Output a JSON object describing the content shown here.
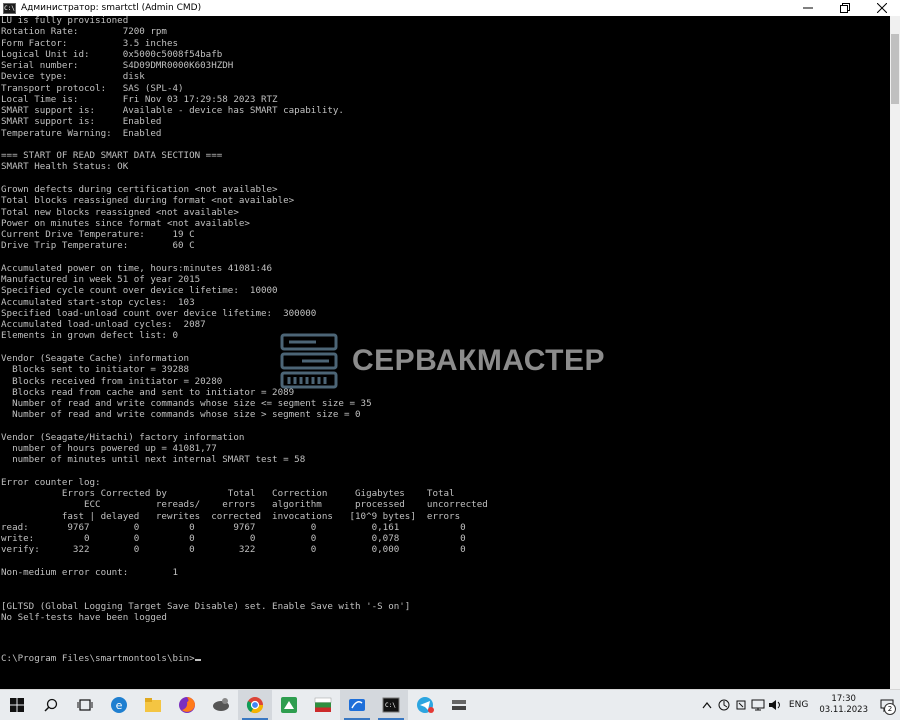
{
  "window": {
    "title": "Администратор: smartctl (Admin CMD)",
    "icon_label": "C:\\"
  },
  "console": {
    "lines": [
      "LU is fully provisioned",
      "Rotation Rate:        7200 rpm",
      "Form Factor:          3.5 inches",
      "Logical Unit id:      0x5000c5008f54bafb",
      "Serial number:        S4D09DMR0000K603HZDH",
      "Device type:          disk",
      "Transport protocol:   SAS (SPL-4)",
      "Local Time is:        Fri Nov 03 17:29:58 2023 RTZ",
      "SMART support is:     Available - device has SMART capability.",
      "SMART support is:     Enabled",
      "Temperature Warning:  Enabled",
      "",
      "=== START OF READ SMART DATA SECTION ===",
      "SMART Health Status: OK",
      "",
      "Grown defects during certification <not available>",
      "Total blocks reassigned during format <not available>",
      "Total new blocks reassigned <not available>",
      "Power on minutes since format <not available>",
      "Current Drive Temperature:     19 C",
      "Drive Trip Temperature:        60 C",
      "",
      "Accumulated power on time, hours:minutes 41081:46",
      "Manufactured in week 51 of year 2015",
      "Specified cycle count over device lifetime:  10000",
      "Accumulated start-stop cycles:  103",
      "Specified load-unload count over device lifetime:  300000",
      "Accumulated load-unload cycles:  2087",
      "Elements in grown defect list: 0",
      "",
      "Vendor (Seagate Cache) information",
      "  Blocks sent to initiator = 39288",
      "  Blocks received from initiator = 20280",
      "  Blocks read from cache and sent to initiator = 2089",
      "  Number of read and write commands whose size <= segment size = 35",
      "  Number of read and write commands whose size > segment size = 0",
      "",
      "Vendor (Seagate/Hitachi) factory information",
      "  number of hours powered up = 41081,77",
      "  number of minutes until next internal SMART test = 58",
      "",
      "Error counter log:",
      "           Errors Corrected by           Total   Correction     Gigabytes    Total",
      "               ECC          rereads/    errors   algorithm      processed    uncorrected",
      "           fast | delayed   rewrites  corrected  invocations   [10^9 bytes]  errors",
      "read:       9767        0         0       9767          0          0,161           0",
      "write:         0        0         0          0          0          0,078           0",
      "verify:      322        0         0        322          0          0,000           0",
      "",
      "Non-medium error count:        1",
      "",
      "",
      "[GLTSD (Global Logging Target Save Disable) set. Enable Save with '-S on']",
      "No Self-tests have been logged",
      "",
      "",
      "C:\\Program Files\\smartmontools\\bin>"
    ]
  },
  "watermark": {
    "text": "СЕРВАКМАСТЕР",
    "color": "#7fb3d6"
  },
  "taskbar": {
    "items": [
      {
        "name": "start-button",
        "icon": "windows-logo"
      },
      {
        "name": "search-button",
        "icon": "search-icon"
      },
      {
        "name": "task-view-button",
        "icon": "task-view-icon"
      },
      {
        "name": "edge-button",
        "icon": "edge-icon"
      },
      {
        "name": "file-explorer-button",
        "icon": "folder-icon"
      },
      {
        "name": "firefox-button",
        "icon": "firefox-icon"
      },
      {
        "name": "app-button-1",
        "icon": "app-icon"
      },
      {
        "name": "chrome-button",
        "icon": "chrome-icon"
      },
      {
        "name": "app-button-2",
        "icon": "app-icon"
      },
      {
        "name": "app-button-3",
        "icon": "app-icon"
      },
      {
        "name": "app-button-4",
        "icon": "app-icon"
      },
      {
        "name": "cmd-button",
        "icon": "cmd-icon"
      },
      {
        "name": "telegram-button",
        "icon": "telegram-icon"
      },
      {
        "name": "app-button-5",
        "icon": "app-icon"
      }
    ],
    "tray": {
      "language": "ENG",
      "time": "17:30",
      "date": "03.11.2023",
      "notification_count": "2"
    }
  },
  "colors": {
    "console_bg": "#000000",
    "console_fg": "#c0c0c0",
    "taskbar_bg": "#e9ecef",
    "accent": "#3a78c2"
  }
}
